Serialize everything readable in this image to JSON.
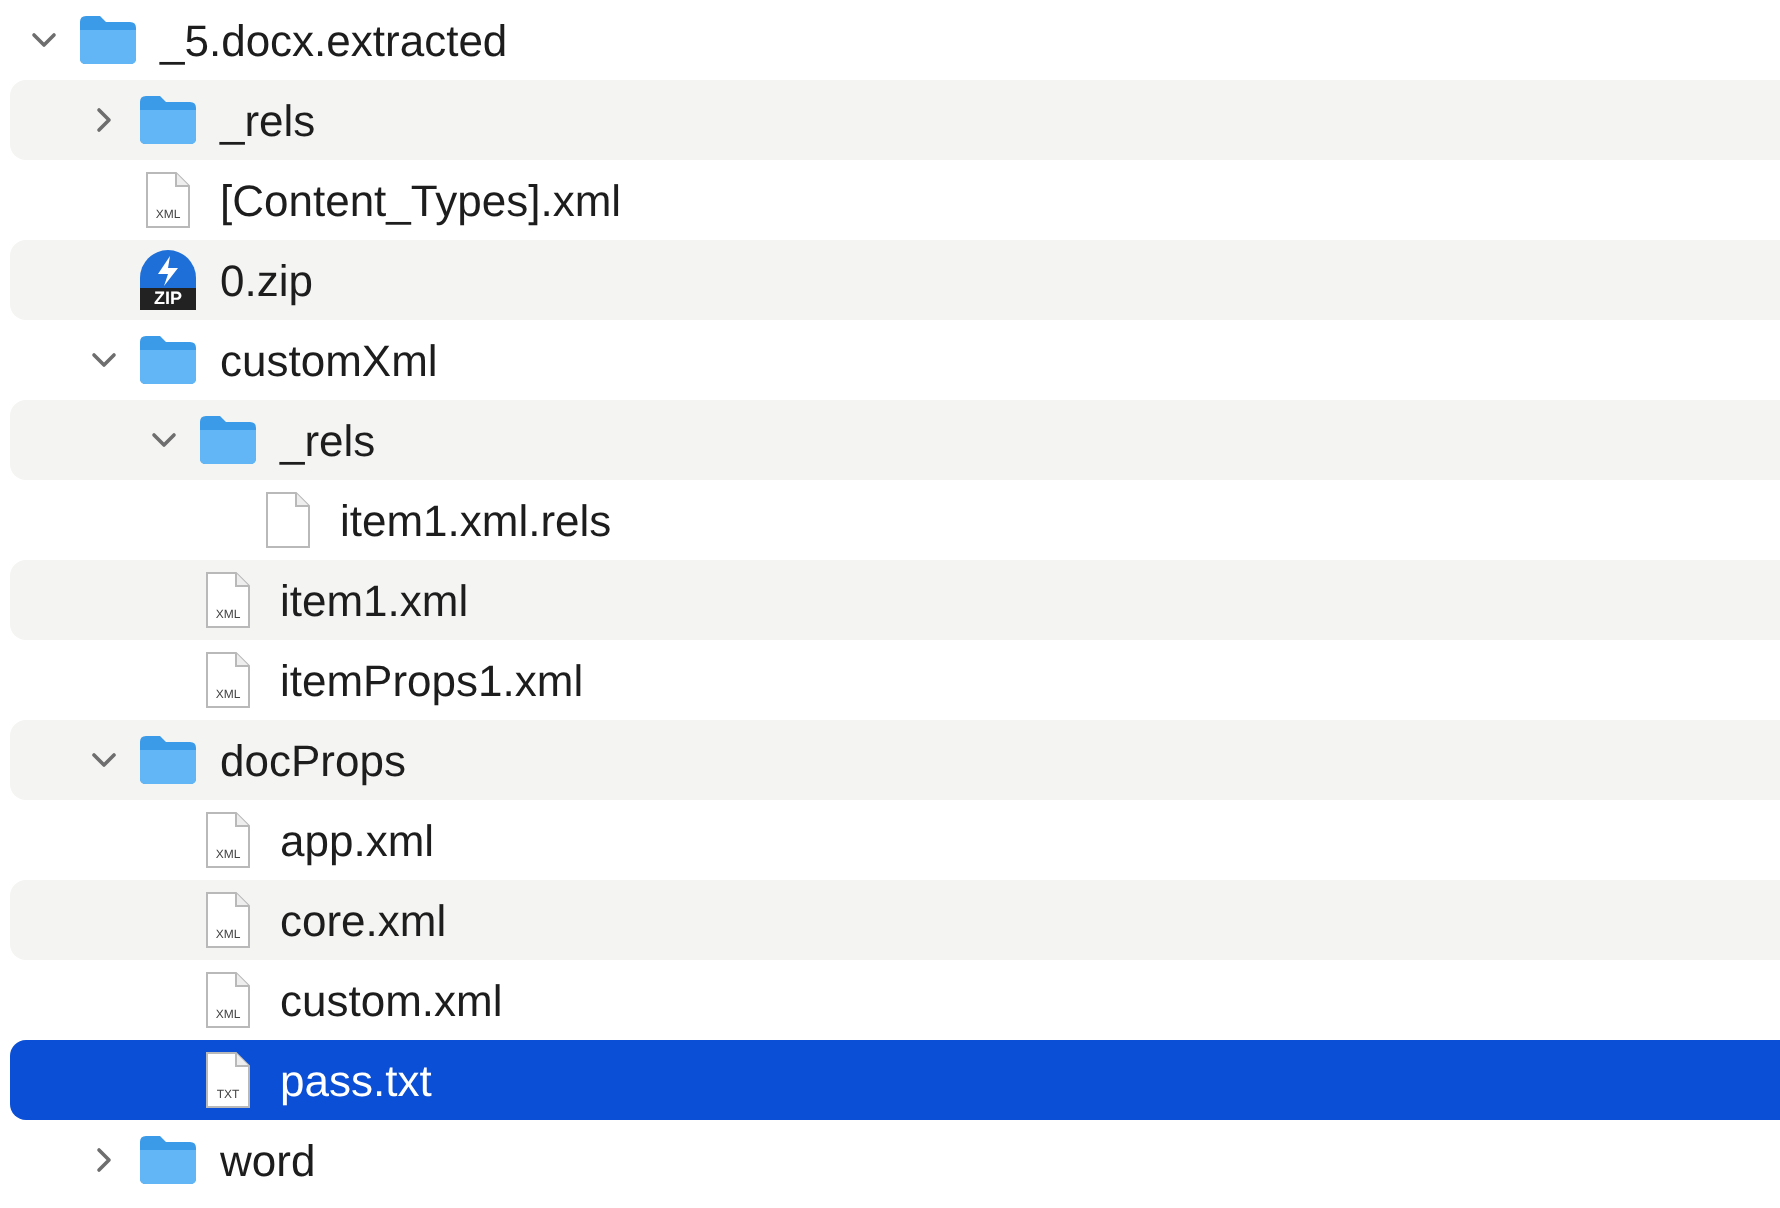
{
  "tree": [
    {
      "name": "_5.docx.extracted",
      "kind": "folder",
      "expanded": true,
      "selected": false,
      "children": [
        {
          "name": "_rels",
          "kind": "folder",
          "expanded": false,
          "selected": false
        },
        {
          "name": "[Content_Types].xml",
          "kind": "file",
          "icon_label": "XML",
          "selected": false
        },
        {
          "name": "0.zip",
          "kind": "archive",
          "icon_label": "ZIP",
          "selected": false
        },
        {
          "name": "customXml",
          "kind": "folder",
          "expanded": true,
          "selected": false,
          "children": [
            {
              "name": "_rels",
              "kind": "folder",
              "expanded": true,
              "selected": false,
              "children": [
                {
                  "name": "item1.xml.rels",
                  "kind": "blank",
                  "selected": false
                }
              ]
            },
            {
              "name": "item1.xml",
              "kind": "file",
              "icon_label": "XML",
              "selected": false
            },
            {
              "name": "itemProps1.xml",
              "kind": "file",
              "icon_label": "XML",
              "selected": false
            }
          ]
        },
        {
          "name": "docProps",
          "kind": "folder",
          "expanded": true,
          "selected": false,
          "children": [
            {
              "name": "app.xml",
              "kind": "file",
              "icon_label": "XML",
              "selected": false
            },
            {
              "name": "core.xml",
              "kind": "file",
              "icon_label": "XML",
              "selected": false
            },
            {
              "name": "custom.xml",
              "kind": "file",
              "icon_label": "XML",
              "selected": false
            },
            {
              "name": "pass.txt",
              "kind": "file",
              "icon_label": "TXT",
              "selected": true
            }
          ]
        },
        {
          "name": "word",
          "kind": "folder",
          "expanded": false,
          "selected": false
        }
      ]
    }
  ]
}
